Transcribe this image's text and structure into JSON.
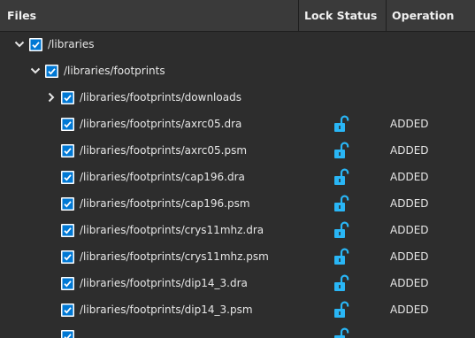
{
  "header": {
    "files": "Files",
    "lock_status": "Lock Status",
    "operation": "Operation"
  },
  "rows": [
    {
      "level": 0,
      "expander": "expanded",
      "checked": true,
      "path": "/libraries",
      "lock": "",
      "operation": ""
    },
    {
      "level": 1,
      "expander": "expanded",
      "checked": true,
      "path": "/libraries/footprints",
      "lock": "",
      "operation": ""
    },
    {
      "level": 2,
      "expander": "collapsed",
      "checked": true,
      "path": "/libraries/footprints/downloads",
      "lock": "",
      "operation": ""
    },
    {
      "level": 2,
      "expander": "none",
      "checked": true,
      "path": "/libraries/footprints/axrc05.dra",
      "lock": "unlocked-icon",
      "operation": "ADDED"
    },
    {
      "level": 2,
      "expander": "none",
      "checked": true,
      "path": "/libraries/footprints/axrc05.psm",
      "lock": "unlocked-icon",
      "operation": "ADDED"
    },
    {
      "level": 2,
      "expander": "none",
      "checked": true,
      "path": "/libraries/footprints/cap196.dra",
      "lock": "unlocked-icon",
      "operation": "ADDED"
    },
    {
      "level": 2,
      "expander": "none",
      "checked": true,
      "path": "/libraries/footprints/cap196.psm",
      "lock": "unlocked-icon",
      "operation": "ADDED"
    },
    {
      "level": 2,
      "expander": "none",
      "checked": true,
      "path": "/libraries/footprints/crys11mhz.dra",
      "lock": "unlocked-icon",
      "operation": "ADDED"
    },
    {
      "level": 2,
      "expander": "none",
      "checked": true,
      "path": "/libraries/footprints/crys11mhz.psm",
      "lock": "unlocked-icon",
      "operation": "ADDED"
    },
    {
      "level": 2,
      "expander": "none",
      "checked": true,
      "path": "/libraries/footprints/dip14_3.dra",
      "lock": "unlocked-icon",
      "operation": "ADDED"
    },
    {
      "level": 2,
      "expander": "none",
      "checked": true,
      "path": "/libraries/footprints/dip14_3.psm",
      "lock": "unlocked-icon",
      "operation": "ADDED"
    },
    {
      "level": 2,
      "expander": "none",
      "checked": true,
      "path": "",
      "lock": "unlocked-icon",
      "operation": ""
    }
  ],
  "colors": {
    "checkbox_accent": "#0078d4",
    "lock_icon": "#29b6f6",
    "background": "#2d2d2d",
    "header_background": "#3a3a3a"
  }
}
